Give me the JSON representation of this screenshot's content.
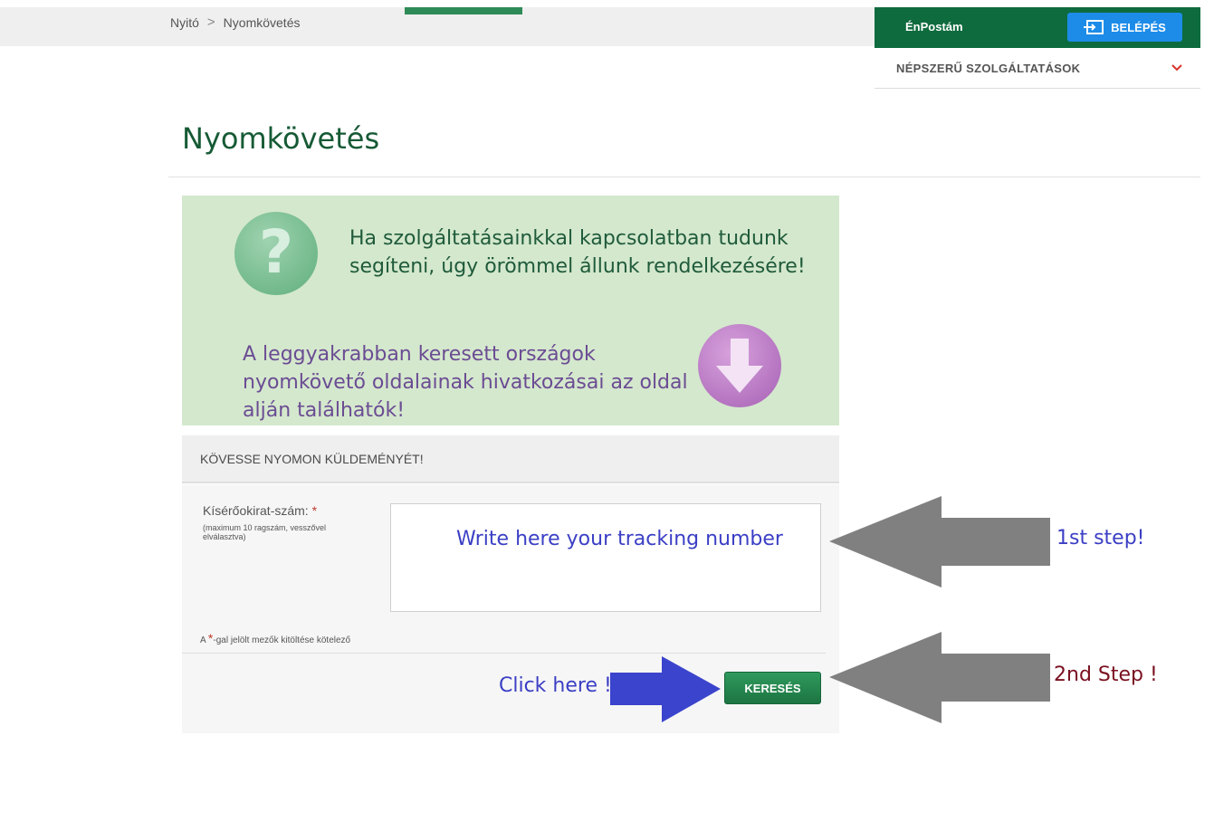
{
  "breadcrumb": {
    "home": "Nyitó",
    "separator": ">",
    "current": "Nyomkövetés"
  },
  "header": {
    "enpostam_label": "ÉnPostám",
    "login_label": "BELÉPÉS",
    "popular_label": "NÉPSZERŰ SZOLGÁLTATÁSOK"
  },
  "page": {
    "title": "Nyomkövetés"
  },
  "banner": {
    "help_text": "Ha szolgáltatásainkkal kapcsolatban tudunk segíteni, úgy örömmel állunk rendelkezésére!",
    "links_text": "A leggyakrabban keresett országok nyomkövető oldalainak hivatkozásai az oldal alján találhatók!",
    "question_mark": "?"
  },
  "form": {
    "heading": "KÖVESSE NYOMON KÜLDEMÉNYÉT!",
    "field_label": "Kísérőokirat-szám:",
    "required_star": "*",
    "field_hint": "(maximum 10 ragszám, vesszővel elválasztva)",
    "field_value": "",
    "field_placeholder": "Write here your tracking number",
    "required_note_prefix": "A ",
    "required_note_suffix": "-gal jelölt mezők kitöltése kötelező",
    "search_label": "KERESÉS"
  },
  "annotations": {
    "click_here": "Click here !",
    "step1": "1st  step!",
    "step2": "2nd Step !"
  },
  "colors": {
    "brand_green": "#0e6b3e",
    "login_blue": "#1d8ce8",
    "title_green": "#165a35",
    "annotation_blue": "#3b3fc4",
    "annotation_red": "#7a1020",
    "arrow_gray": "#808080"
  },
  "icons": {
    "login": "login-icon",
    "chevron": "chevron-down-icon",
    "help": "question-circle-icon",
    "down": "down-arrow-circle-icon"
  }
}
